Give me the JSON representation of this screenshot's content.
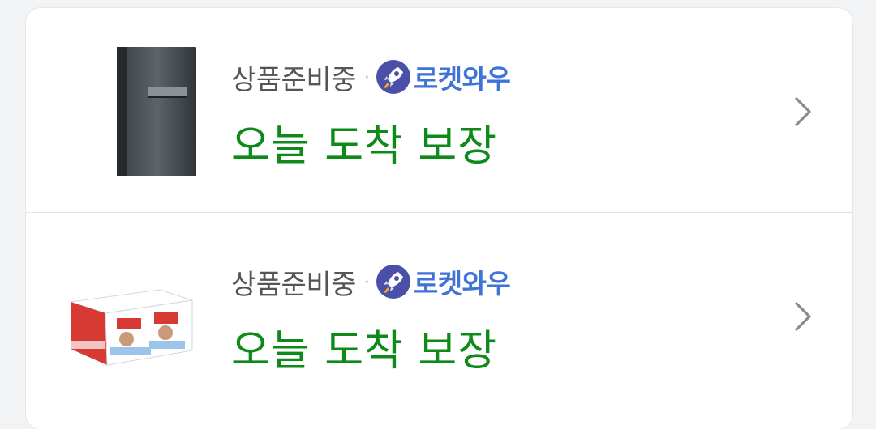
{
  "items": [
    {
      "product_icon": "black-case-product-image",
      "status": "상품준비중",
      "separator": "·",
      "membership_icon": "rocket-icon",
      "membership_label": "로켓와우",
      "delivery": "오늘 도착 보장",
      "chevron_icon": "chevron-right-icon"
    },
    {
      "product_icon": "chocolate-box-product-image",
      "status": "상품준비중",
      "separator": "·",
      "membership_icon": "rocket-icon",
      "membership_label": "로켓와우",
      "delivery": "오늘 도착 보장",
      "chevron_icon": "chevron-right-icon"
    }
  ],
  "colors": {
    "status": "#555555",
    "membership": "#3f74d6",
    "delivery": "#0d8a1a",
    "badge": "#4a4fa8"
  }
}
